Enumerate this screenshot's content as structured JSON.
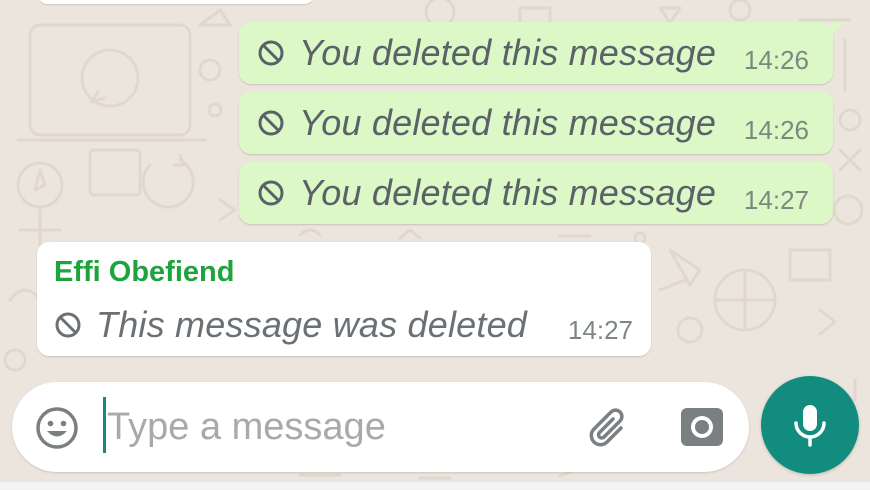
{
  "conversation": {
    "outgoing_messages": [
      {
        "text": "You deleted this message",
        "time": "14:26"
      },
      {
        "text": "You deleted this message",
        "time": "14:26"
      },
      {
        "text": "You deleted this message",
        "time": "14:27"
      }
    ],
    "incoming_message": {
      "sender": "Effi Obefiend",
      "text": "This message was deleted",
      "time": "14:27"
    }
  },
  "composer": {
    "placeholder": "Type a message",
    "value": ""
  },
  "icons": {
    "deleted": "ban-icon",
    "emoji": "emoji-icon",
    "attach": "paperclip-icon",
    "camera": "camera-icon",
    "mic": "microphone-icon"
  },
  "colors": {
    "outgoing_bubble": "#dcf8c6",
    "incoming_bubble": "#ffffff",
    "sender_name": "#1fa33c",
    "accent": "#128c7e",
    "chat_background": "#ece5dd"
  }
}
